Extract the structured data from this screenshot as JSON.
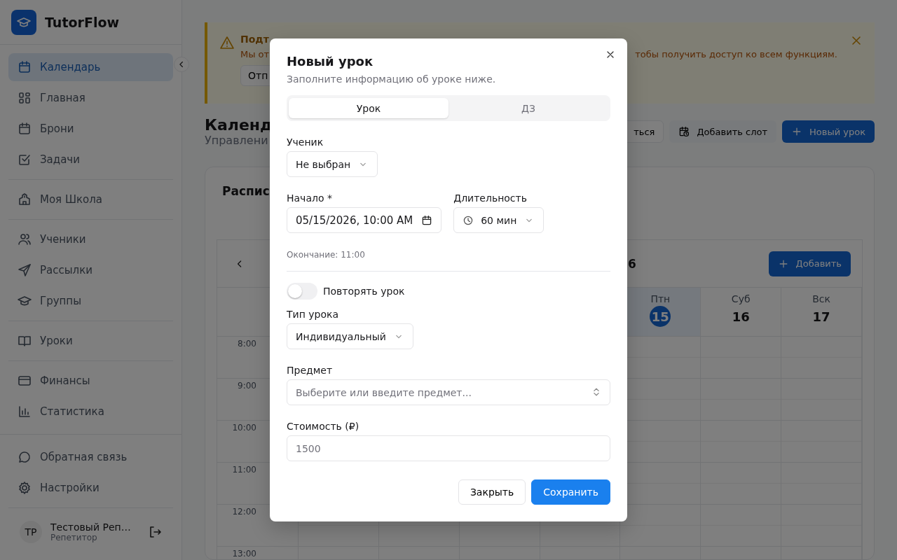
{
  "app": {
    "name": "TutorFlow"
  },
  "sidebar": {
    "groups": [
      {
        "items": [
          {
            "label": "Календарь",
            "selected": true
          },
          {
            "label": "Главная",
            "selected": false
          },
          {
            "label": "Брони",
            "selected": false
          },
          {
            "label": "Задачи",
            "selected": false
          }
        ]
      },
      {
        "items": [
          {
            "label": "Моя Школа",
            "selected": false
          }
        ]
      },
      {
        "items": [
          {
            "label": "Ученики",
            "selected": false
          },
          {
            "label": "Рассылки",
            "selected": false
          },
          {
            "label": "Группы",
            "selected": false
          }
        ]
      },
      {
        "items": [
          {
            "label": "Уроки",
            "selected": false
          }
        ]
      },
      {
        "items": [
          {
            "label": "Финансы",
            "selected": false
          },
          {
            "label": "Статистика",
            "selected": false
          }
        ]
      }
    ],
    "footer_items": [
      {
        "label": "Обратная связь",
        "selected": false
      },
      {
        "label": "Настройки",
        "selected": false
      }
    ],
    "user": {
      "initials": "ТР",
      "name": "Тестовый Реп…",
      "role": "Репетитор"
    }
  },
  "banner": {
    "title": "Подт",
    "line_start": "Мы от",
    "line_end": "тобы получить доступ ко всем функциям.",
    "button": "Отп"
  },
  "page": {
    "title": "Календ",
    "subtitle": "Управлени",
    "actions": [
      {
        "kind": "outline",
        "label": "ться"
      },
      {
        "kind": "secondary",
        "label": "Добавить слот"
      },
      {
        "kind": "primary",
        "label": "Новый урок"
      }
    ]
  },
  "schedule": {
    "title": "Распис",
    "heading": "6",
    "add_button": "Добавить",
    "days": [
      {
        "weekday": "Птн",
        "date": "15",
        "selected": true
      },
      {
        "weekday": "Суб",
        "date": "16",
        "selected": false
      },
      {
        "weekday": "Вск",
        "date": "17",
        "selected": false
      }
    ],
    "times": [
      "8:00",
      "9:00",
      "10:00",
      "11:00",
      "12:00",
      "13:00"
    ]
  },
  "dialog": {
    "title": "Новый урок",
    "subtitle": "Заполните информацию об уроке ниже.",
    "tabs": [
      {
        "label": "Урок",
        "selected": true
      },
      {
        "label": "ДЗ",
        "selected": false
      }
    ],
    "student": {
      "label": "Ученик",
      "value": "Не выбран"
    },
    "start": {
      "label": "Начало *",
      "value": "05/15/2026, 10:00 AM"
    },
    "duration": {
      "label": "Длительность",
      "value": "60 мин"
    },
    "end_note": "Окончание: 11:00",
    "repeat": {
      "label": "Повторять урок",
      "on": false
    },
    "lesson_type": {
      "label": "Тип урока",
      "value": "Индивидуальный"
    },
    "subject": {
      "label": "Предмет",
      "placeholder": "Выберите или введите предмет..."
    },
    "price": {
      "label": "Стоимость (₽)",
      "placeholder": "1500"
    },
    "buttons": [
      {
        "kind": "secondary",
        "label": "Закрыть"
      },
      {
        "kind": "primary",
        "label": "Сохранить"
      }
    ]
  }
}
